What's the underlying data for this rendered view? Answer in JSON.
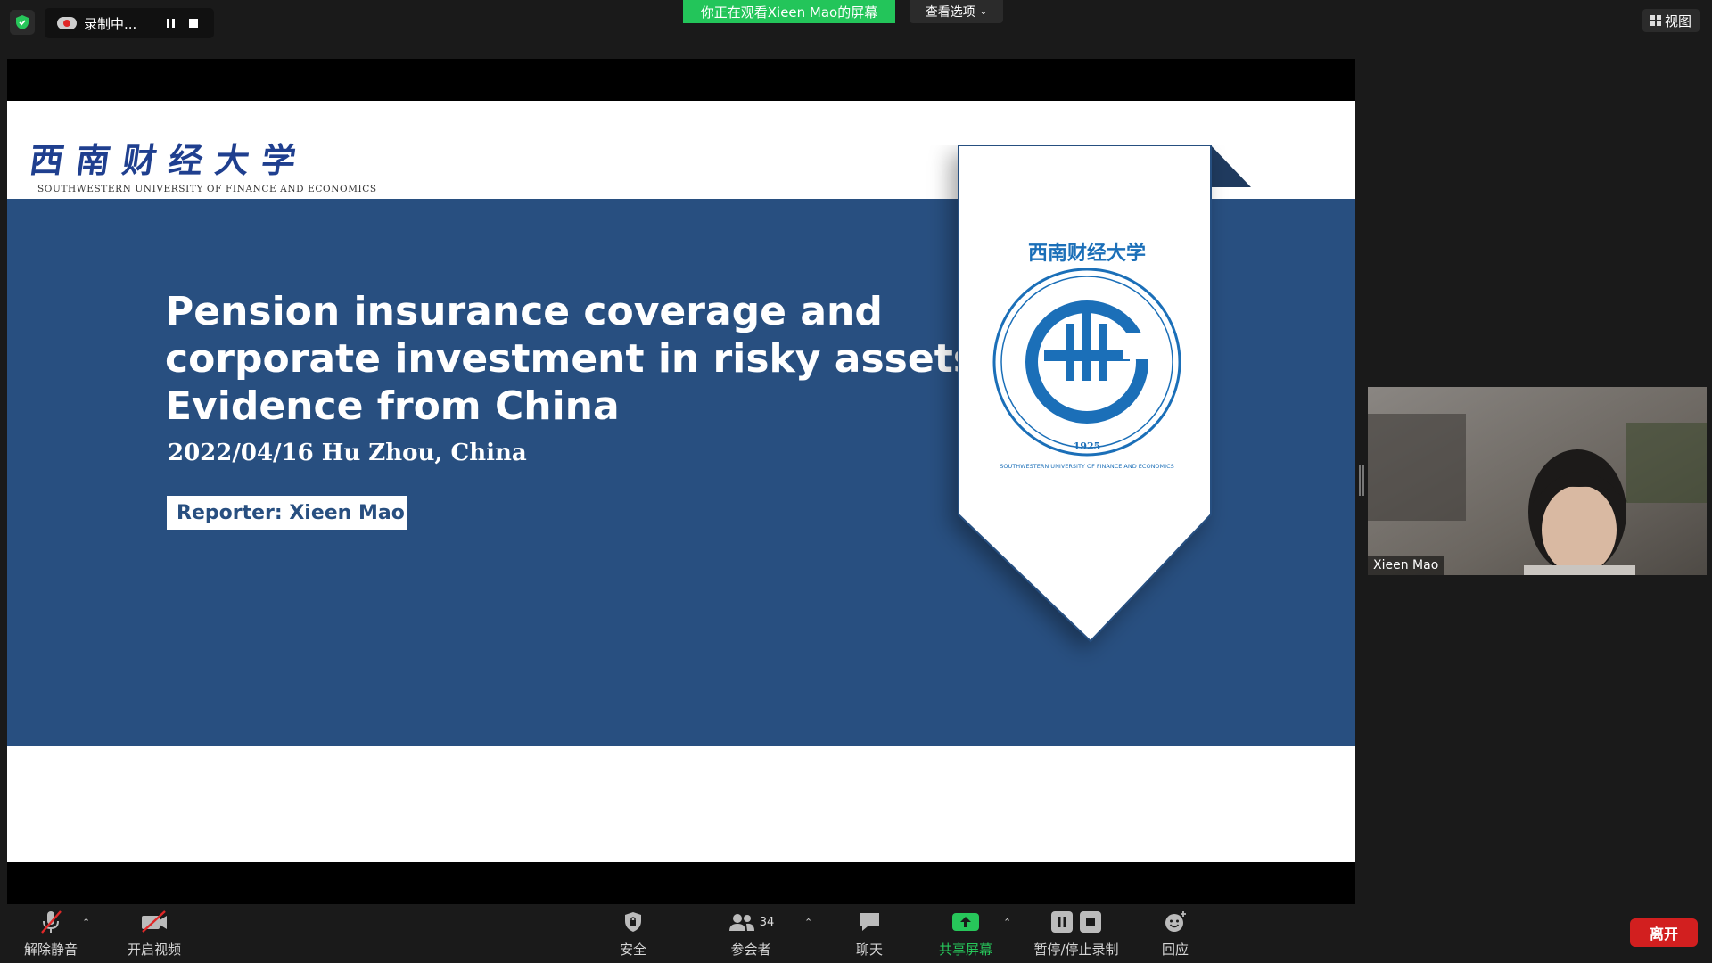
{
  "topbar": {
    "recording_label": "录制中...",
    "viewing_banner": "你正在观看Xieen  Mao的屏幕",
    "view_options_label": "查看选项",
    "view_toggle_label": "视图"
  },
  "slide": {
    "university_name_cn": "西南财经大学",
    "university_name_en": "SOUTHWESTERN UNIVERSITY OF FINANCE AND ECONOMICS",
    "title_lines": [
      "Pension insurance coverage and",
      "corporate investment in risky assets:",
      "Evidence from China"
    ],
    "date_location": "2022/04/16 Hu Zhou, China",
    "reporter": "Reporter:  Xieen Mao",
    "emblem_year": "1925",
    "colors": {
      "slide_blue": "#284f80",
      "emblem_blue": "#1b6fb8",
      "banner_green": "#23c55a"
    }
  },
  "participant_video": {
    "name": "Xieen Mao"
  },
  "toolbar": {
    "unmute_label": "解除静音",
    "start_video_label": "开启视频",
    "security_label": "安全",
    "participants_label": "参会者",
    "participants_count": "34",
    "chat_label": "聊天",
    "share_screen_label": "共享屏幕",
    "recording_control_label": "暂停/停止录制",
    "reactions_label": "回应",
    "leave_label": "离开"
  }
}
